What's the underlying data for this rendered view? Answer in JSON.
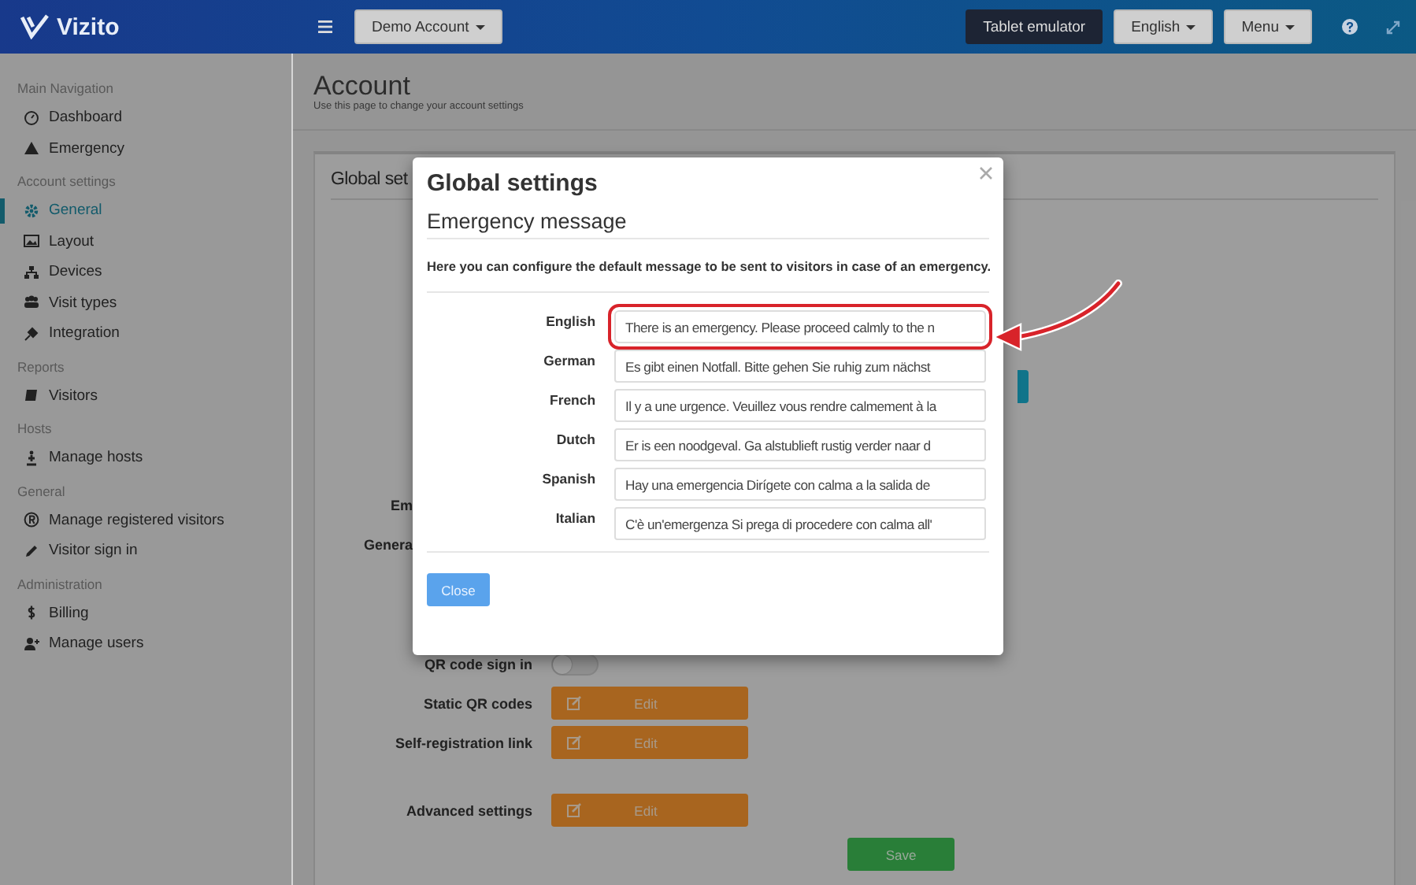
{
  "header": {
    "logo": "Vizito",
    "account_button": "Demo Account",
    "buttons": [
      {
        "label": "Tablet emulator",
        "kind": "dark"
      },
      {
        "label": "English",
        "kind": "dropdown"
      },
      {
        "label": "Menu",
        "kind": "dropdown"
      }
    ]
  },
  "sidebar": {
    "sections": [
      {
        "heading": "Main Navigation",
        "items": [
          {
            "label": "Dashboard",
            "selected": false
          },
          {
            "label": "Emergency",
            "selected": false
          }
        ]
      },
      {
        "heading": "Account settings",
        "items": [
          {
            "label": "General",
            "selected": true
          },
          {
            "label": "Layout",
            "selected": false
          },
          {
            "label": "Devices",
            "selected": false
          },
          {
            "label": "Visit types",
            "selected": false
          },
          {
            "label": "Integration",
            "selected": false
          }
        ]
      },
      {
        "heading": "Reports",
        "items": [
          {
            "label": "Visitors",
            "selected": false
          }
        ]
      },
      {
        "heading": "Hosts",
        "items": [
          {
            "label": "Manage hosts",
            "selected": false
          }
        ]
      },
      {
        "heading": "General",
        "items": [
          {
            "label": "Manage registered visitors",
            "selected": false
          },
          {
            "label": "Visitor sign in",
            "selected": false
          }
        ]
      },
      {
        "heading": "Administration",
        "items": [
          {
            "label": "Billing",
            "selected": false
          },
          {
            "label": "Manage users",
            "selected": false
          }
        ]
      }
    ]
  },
  "page": {
    "title": "Account",
    "subtitle": "Use this page to change your account settings",
    "card": {
      "title": "Global set",
      "partial_labels": [
        "Em",
        "Genera"
      ],
      "settings": [
        {
          "label": "QR code sign in",
          "kind": "toggle",
          "on": false
        },
        {
          "label": "Static QR codes",
          "kind": "edit",
          "button": "Edit"
        },
        {
          "label": "Self-registration link",
          "kind": "edit",
          "button": "Edit"
        },
        {
          "label": "Advanced settings",
          "kind": "edit",
          "button": "Edit"
        }
      ],
      "save_button": "Save"
    }
  },
  "modal": {
    "title": "Global settings",
    "subtitle": "Emergency message",
    "description": "Here you can configure the default message to be sent to visitors in case of an emergency.",
    "languages": [
      {
        "label": "English",
        "value": "There is an emergency. Please proceed calmly to the n",
        "highlighted": true
      },
      {
        "label": "German",
        "value": "Es gibt einen Notfall. Bitte gehen Sie ruhig zum nächst",
        "highlighted": false
      },
      {
        "label": "French",
        "value": "Il y a une urgence. Veuillez vous rendre calmement à la",
        "highlighted": false
      },
      {
        "label": "Dutch",
        "value": "Er is een noodgeval. Ga alstublieft rustig verder naar d",
        "highlighted": false
      },
      {
        "label": "Spanish",
        "value": "Hay una emergencia Dirígete con calma a la salida de",
        "highlighted": false
      },
      {
        "label": "Italian",
        "value": "C'è un'emergenza Si prega di procedere con calma all'",
        "highlighted": false
      }
    ],
    "close_button": "Close"
  }
}
